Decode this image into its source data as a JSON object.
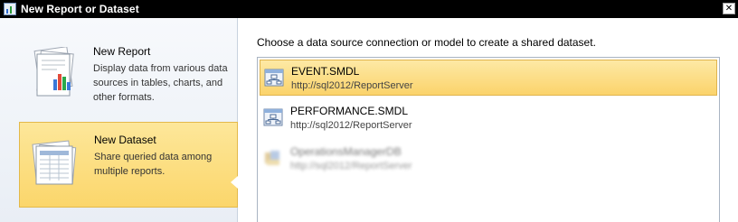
{
  "window": {
    "title": "New Report or Dataset",
    "close_label": "✕"
  },
  "left_panel": {
    "options": [
      {
        "title": "New Report",
        "description": "Display data from various data sources in tables, charts, and other formats.",
        "icon": "report-icon",
        "selected": false
      },
      {
        "title": "New Dataset",
        "description": "Share queried data among multiple reports.",
        "icon": "dataset-icon",
        "selected": true
      }
    ]
  },
  "main": {
    "prompt": "Choose a data source connection or model to create a shared dataset.",
    "sources": [
      {
        "name": "EVENT.SMDL",
        "url": "http://sql2012/ReportServer",
        "icon": "model-icon",
        "selected": true,
        "blurred": false
      },
      {
        "name": "PERFORMANCE.SMDL",
        "url": "http://sql2012/ReportServer",
        "icon": "model-icon",
        "selected": false,
        "blurred": false
      },
      {
        "name": "OperationsManagerDB",
        "url": "http://sql2012/ReportServer",
        "icon": "data-source-icon",
        "selected": false,
        "blurred": true
      }
    ]
  },
  "colors": {
    "selection": "#fbd66b",
    "selection_border": "#e0b44c",
    "titlebar": "#000000"
  }
}
